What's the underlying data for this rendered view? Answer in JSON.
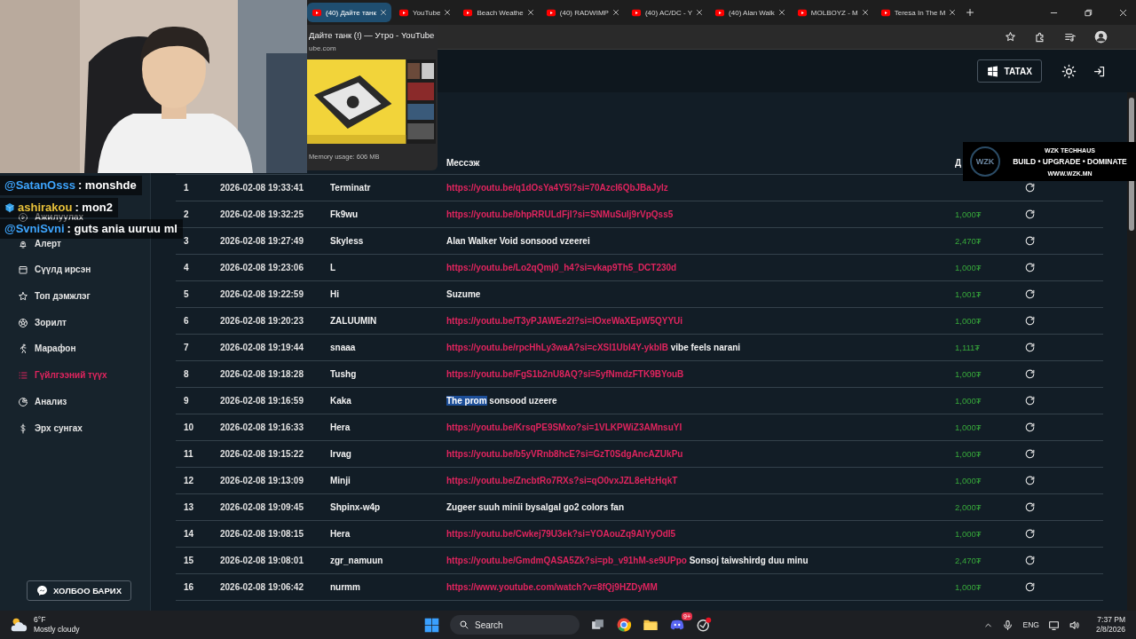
{
  "browser": {
    "tabs": [
      {
        "title": "(40) Дайте танк",
        "selected": true
      },
      {
        "title": "YouTube",
        "selected": false
      },
      {
        "title": "Beach Weathe",
        "selected": false
      },
      {
        "title": "(40) RADWIMP",
        "selected": false
      },
      {
        "title": "(40) AC/DC - Y",
        "selected": false
      },
      {
        "title": "(40) Alan Walk",
        "selected": false
      },
      {
        "title": "MOLBOYZ - M",
        "selected": false
      },
      {
        "title": "Teresa In The M",
        "selected": false
      }
    ],
    "hover_card": {
      "title": "Дайте танк (!) — Утро - YouTube",
      "url": "ube.com",
      "memory": "Memory usage: 606 MB",
      "kind": "picture"
    }
  },
  "app": {
    "header": {
      "download_button": "ТАТАХ"
    },
    "sidebar": {
      "items": [
        {
          "label": "Ажилуулах",
          "selected": false
        },
        {
          "label": "Алерт",
          "selected": false
        },
        {
          "label": "Сүүлд ирсэн",
          "selected": false
        },
        {
          "label": "Топ дэмжлэг",
          "selected": false
        },
        {
          "label": "Зорилт",
          "selected": false
        },
        {
          "label": "Марафон",
          "selected": false
        },
        {
          "label": "Гүйлгээний түүх",
          "selected": true
        },
        {
          "label": "Анализ",
          "selected": false
        },
        {
          "label": "Эрх сунгах",
          "selected": false
        }
      ],
      "contact_button": "ХОЛБОО БАРИХ"
    },
    "table": {
      "columns": {
        "message": "Мессэж",
        "amount": "Д"
      },
      "rows": [
        {
          "number": "1",
          "time": "2026-02-08 19:33:41",
          "name": "Terminatr",
          "message": [
            {
              "kind": "link",
              "text": "https://youtu.be/q1dOsYa4Y5I?si=70AzcI6QbJBaJylz"
            }
          ]
        },
        {
          "number": "2",
          "time": "2026-02-08 19:32:25",
          "name": "Fk9wu",
          "message": [
            {
              "kind": "link",
              "text": "https://youtu.be/bhpRRULdFjI?si=SNMuSuIj9rVpQss5"
            }
          ],
          "amount": "1,000₮"
        },
        {
          "number": "3",
          "time": "2026-02-08 19:27:49",
          "name": "Skyless",
          "message": [
            {
              "kind": "text",
              "text": "Alan Walker Void sonsood vzeerei"
            }
          ],
          "amount": "2,470₮"
        },
        {
          "number": "4",
          "time": "2026-02-08 19:23:06",
          "name": "L",
          "message": [
            {
              "kind": "link",
              "text": "https://youtu.be/Lo2qQmj0_h4?si=vkap9Th5_DCT230d"
            }
          ],
          "amount": "1,000₮"
        },
        {
          "number": "5",
          "time": "2026-02-08 19:22:59",
          "name": "Hi",
          "message": [
            {
              "kind": "text",
              "text": "Suzume"
            }
          ],
          "amount": "1,001₮"
        },
        {
          "number": "6",
          "time": "2026-02-08 19:20:23",
          "name": "ZALUUMIN",
          "message": [
            {
              "kind": "link",
              "text": "https://youtu.be/T3yPJAWEe2I?si=IOxeWaXEpW5QYYUi"
            }
          ],
          "amount": "1,000₮"
        },
        {
          "number": "7",
          "time": "2026-02-08 19:19:44",
          "name": "snaaa",
          "message": [
            {
              "kind": "link",
              "text": "https://youtu.be/rpcHhLy3waA?si=cXSI1UbI4Y-ykblB"
            },
            {
              "kind": "text",
              "text": "vibe feels narani"
            }
          ],
          "amount": "1,111₮"
        },
        {
          "number": "8",
          "time": "2026-02-08 19:18:28",
          "name": "Tushg",
          "message": [
            {
              "kind": "link",
              "text": "https://youtu.be/FgS1b2nU8AQ?si=5yfNmdzFTK9BYouB"
            }
          ],
          "amount": "1,000₮"
        },
        {
          "number": "9",
          "time": "2026-02-08 19:16:59",
          "name": "Kaka",
          "message": [
            {
              "kind": "text",
              "text": "The prom",
              "highlighted": true
            },
            {
              "kind": "text",
              "text": "sonsood uzeere",
              "highlighted": false
            }
          ],
          "amount": "1,000₮"
        },
        {
          "number": "10",
          "time": "2026-02-08 19:16:33",
          "name": "Hera",
          "message": [
            {
              "kind": "link",
              "text": "https://youtu.be/KrsqPE9SMxo?si=1VLKPWiZ3AMnsuYI"
            }
          ],
          "amount": "1,000₮"
        },
        {
          "number": "11",
          "time": "2026-02-08 19:15:22",
          "name": "Irvag",
          "message": [
            {
              "kind": "link",
              "text": "https://youtu.be/b5yVRnb8hcE?si=GzT0SdgAncAZUkPu"
            }
          ],
          "amount": "1,000₮"
        },
        {
          "number": "12",
          "time": "2026-02-08 19:13:09",
          "name": "Minji",
          "message": [
            {
              "kind": "link",
              "text": "https://youtu.be/ZncbtRo7RXs?si=qO0vxJZL8eHzHqkT"
            }
          ],
          "amount": "1,000₮"
        },
        {
          "number": "13",
          "time": "2026-02-08 19:09:45",
          "name": "Shpinx-w4p",
          "message": [
            {
              "kind": "text",
              "text": "Zugeer suuh minii bysalgal go2 colors fan"
            }
          ],
          "amount": "2,000₮"
        },
        {
          "number": "14",
          "time": "2026-02-08 19:08:15",
          "name": "Hera",
          "message": [
            {
              "kind": "link",
              "text": "https://youtu.be/Cwkej79U3ek?si=YOAouZq9AlYyOdl5"
            }
          ],
          "amount": "1,000₮"
        },
        {
          "number": "15",
          "time": "2026-02-08 19:08:01",
          "name": "zgr_namuun",
          "message": [
            {
              "kind": "link",
              "text": "https://youtu.be/GmdmQASA5Zk?si=pb_v91hM-se9UPpo"
            },
            {
              "kind": "text",
              "text": "Sonsoj taiwshirdg duu minu"
            }
          ],
          "amount": "2,470₮"
        },
        {
          "number": "16",
          "time": "2026-02-08 19:06:42",
          "name": "nurmm",
          "message": [
            {
              "kind": "link",
              "text": "https://www.youtube.com/watch?v=8fQj9HZDyMM"
            }
          ],
          "amount": "1,000₮"
        }
      ]
    }
  },
  "overlays": {
    "chat": [
      {
        "user": "@SatanOsss",
        "color": "#3ea6ff",
        "text": ": monshde",
        "badge": false
      },
      {
        "user": "ashirakou",
        "color": "#e8c13a",
        "text": ": mon2",
        "badge": true
      },
      {
        "user": "@SvniSvni",
        "color": "#3ea6ff",
        "text": ": guts ania uuruu ml",
        "badge": false
      }
    ],
    "sponsor": {
      "logo": "WZK",
      "name": "WZK TECHHAUS",
      "tagline": "BUILD • UPGRADE • DOMINATE",
      "url": "WWW.WZK.MN"
    }
  },
  "taskbar": {
    "weather": {
      "temperature": "6°F",
      "condition": "Mostly cloudy"
    },
    "search": {
      "placeholder": "Search"
    },
    "chat_badge": "9+",
    "language": "ENG",
    "time": "7:37 PM",
    "date": "2/8/2026"
  }
}
